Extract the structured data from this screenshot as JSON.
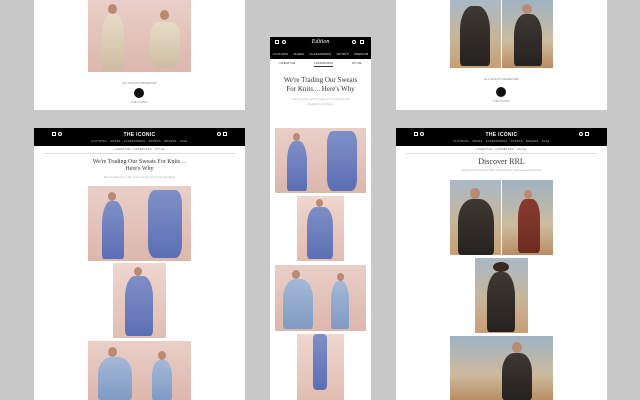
{
  "top_left": {
    "caption": "ALL RIGHTS RESERVED",
    "logo_caption": "THE ICONIC"
  },
  "top_right": {
    "caption": "ALL RIGHTS RESERVED",
    "logo_caption": "THE ICONIC"
  },
  "desktop_left": {
    "brand": "THE ICONIC",
    "nav": "CLOTHING · SHOES · ACCESSORIES · SPORTS · BRANDS · SALE",
    "subnav": "LIFESTYLE · LOOKBOOKS · STYLE",
    "title_line1": "We're Trading Our Sweats For Knits ...",
    "title_line2": "Here's Why",
    "subtitle": "The smooth factor only we're running off limited everything"
  },
  "mobile": {
    "brand": "Edition",
    "nav": [
      "CLOTHING",
      "SHOES",
      "ACCESSORIES",
      "SPORTS",
      "PREMIUM"
    ],
    "tabs": [
      "LIFESTYLE",
      "LOOKBOOKS",
      "STYLE"
    ],
    "title_line1": "We're Trading Our Sweats",
    "title_line2": "For Knits ... Here's Why",
    "subtitle_line1": "The smooth factor only we're running off",
    "subtitle_line2": "limited everything."
  },
  "desktop_right": {
    "brand": "THE ICONIC",
    "nav": "CLOTHING · SHOES · ACCESSORIES · SPORTS · BRANDS · SALE",
    "subnav": "LIFESTYLE · LOOKBOOKS · STYLE",
    "title": "Discover RRL",
    "subtitle": "Explore the world of RRL and find your new favourite pieces"
  }
}
